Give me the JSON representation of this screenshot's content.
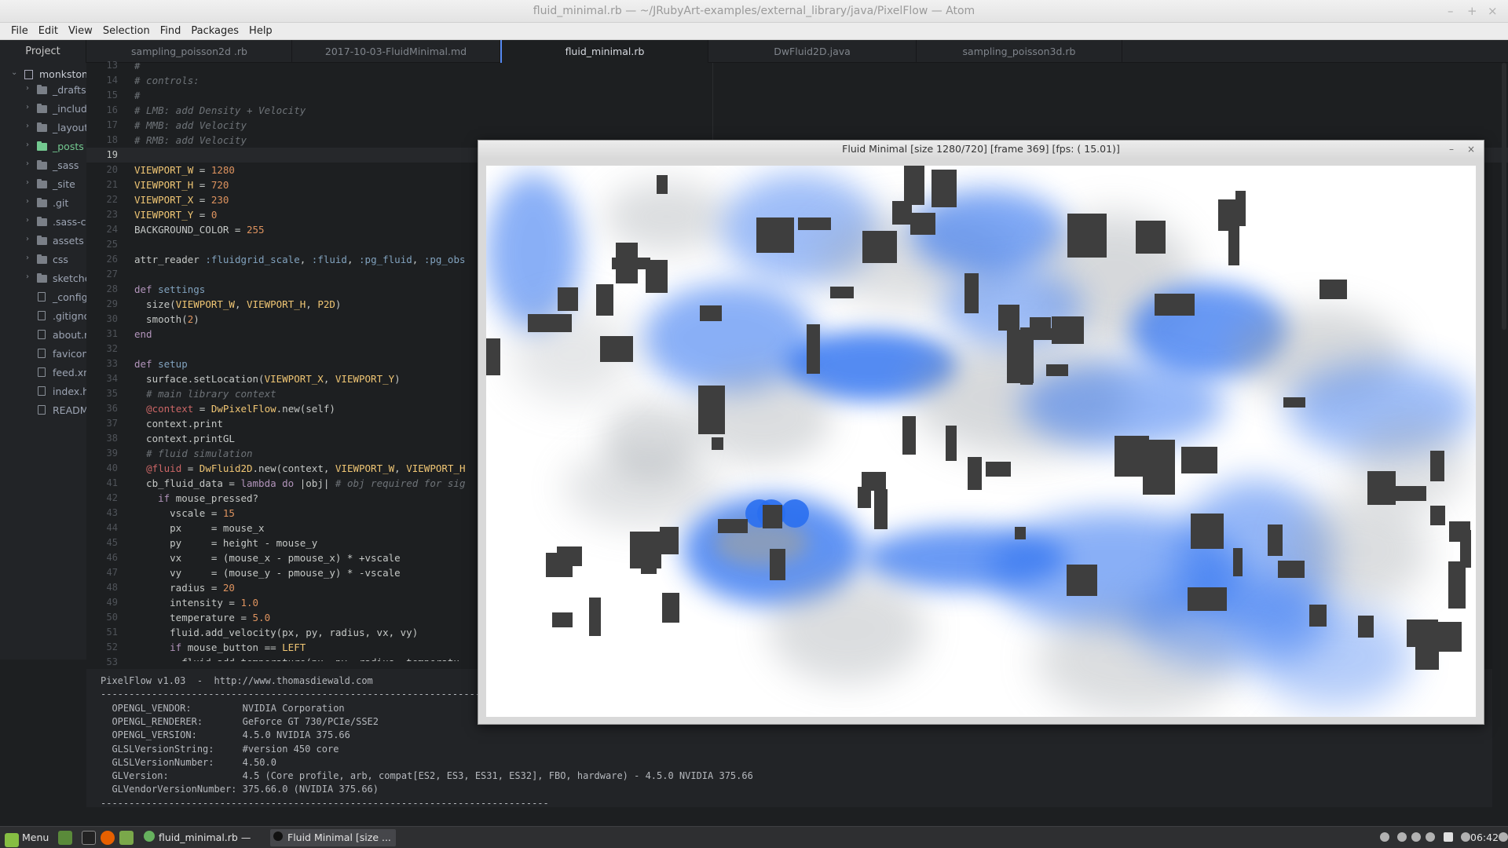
{
  "window": {
    "title": "fluid_minimal.rb — ~/JRubyArt-examples/external_library/java/PixelFlow — Atom",
    "controls": [
      "–",
      "+",
      "×"
    ]
  },
  "menu": [
    "File",
    "Edit",
    "View",
    "Selection",
    "Find",
    "Packages",
    "Help"
  ],
  "tabs": {
    "project": "Project",
    "items": [
      {
        "label": "sampling_poisson2d .rb",
        "active": false
      },
      {
        "label": "2017-10-03-FluidMinimal.md",
        "active": false
      },
      {
        "label": "fluid_minimal.rb",
        "active": true
      },
      {
        "label": "DwFluid2D.java",
        "active": false
      },
      {
        "label": "sampling_poisson3d.rb",
        "active": false
      }
    ]
  },
  "tree": {
    "root": "monkstone",
    "items": [
      {
        "label": "_drafts",
        "type": "folder"
      },
      {
        "label": "_includ",
        "type": "folder"
      },
      {
        "label": "_layout",
        "type": "folder"
      },
      {
        "label": "_posts",
        "type": "folder",
        "selected": true
      },
      {
        "label": "_sass",
        "type": "folder"
      },
      {
        "label": "_site",
        "type": "folder"
      },
      {
        "label": ".git",
        "type": "folder"
      },
      {
        "label": ".sass-ca",
        "type": "folder"
      },
      {
        "label": "assets",
        "type": "folder"
      },
      {
        "label": "css",
        "type": "folder"
      },
      {
        "label": "sketche",
        "type": "folder"
      },
      {
        "label": "_config",
        "type": "file"
      },
      {
        "label": ".gitigno",
        "type": "file"
      },
      {
        "label": "about.r",
        "type": "file"
      },
      {
        "label": "favicon",
        "type": "file"
      },
      {
        "label": "feed.xn",
        "type": "file"
      },
      {
        "label": "index.h",
        "type": "file"
      },
      {
        "label": "READM",
        "type": "file"
      }
    ]
  },
  "editor": {
    "first_line": 13,
    "current_line": 19,
    "lines": [
      "#",
      "# controls:",
      "#",
      "# LMB: add Density + Velocity",
      "# MMB: add Velocity",
      "# RMB: add Velocity",
      "",
      "VIEWPORT_W = 1280",
      "VIEWPORT_H = 720",
      "VIEWPORT_X = 230",
      "VIEWPORT_Y = 0",
      "BACKGROUND_COLOR = 255",
      "",
      "attr_reader :fluidgrid_scale, :fluid, :pg_fluid, :pg_obs",
      "",
      "def settings",
      "  size(VIEWPORT_W, VIEWPORT_H, P2D)",
      "  smooth(2)",
      "end",
      "",
      "def setup",
      "  surface.setLocation(VIEWPORT_X, VIEWPORT_Y)",
      "  # main library context",
      "  @context = DwPixelFlow.new(self)",
      "  context.print",
      "  context.printGL",
      "  # fluid simulation",
      "  @fluid = DwFluid2D.new(context, VIEWPORT_W, VIEWPORT_H",
      "  cb_fluid_data = lambda do |obj| # obj required for sig",
      "    if mouse_pressed?",
      "      vscale = 15",
      "      px     = mouse_x",
      "      py     = height - mouse_y",
      "      vx     = (mouse_x - pmouse_x) * +vscale",
      "      vy     = (mouse_y - pmouse_y) * -vscale",
      "      radius = 20",
      "      intensity = 1.0",
      "      temperature = 5.0",
      "      fluid.add_velocity(px, py, radius, vx, vy)",
      "      if mouse_button == LEFT",
      "        fluid.add_temperature(px, py, radius, temperatu"
    ]
  },
  "console": {
    "lines": [
      "PixelFlow v1.03  -  http://www.thomasdiewald.com",
      "-------------------------------------------------------------------------------",
      "  OPENGL_VENDOR:         NVIDIA Corporation",
      "  OPENGL_RENDERER:       GeForce GT 730/PCIe/SSE2",
      "  OPENGL_VERSION:        4.5.0 NVIDIA 375.66",
      "  GLSLVersionString:     #version 450 core",
      "  GLSLVersionNumber:     4.50.0",
      "  GLVersion:             4.5 (Core profile, arb, compat[ES2, ES3, ES31, ES32], FBO, hardware) - 4.5.0 NVIDIA 375.66",
      "  GLVendorVersionNumber: 375.66.0 (NVIDIA 375.66)",
      "-------------------------------------------------------------------------------"
    ]
  },
  "sketch": {
    "title": "Fluid Minimal  [size 1280/720]  [frame 369]  [fps: ( 15.01)]",
    "controls": [
      "–",
      "×"
    ],
    "colors": {
      "fluid": "#2a6ff0",
      "smoke": "#9aa0a6",
      "obstacle": "#3e3e3e",
      "background": "#ffffff"
    }
  },
  "taskbar": {
    "menu_label": "Menu",
    "windows": [
      {
        "label": "fluid_minimal.rb — ~...",
        "active": false
      },
      {
        "label": "Fluid Minimal  [size ...",
        "active": true
      }
    ],
    "clock": "06:42",
    "tray_icons": [
      "user-icon",
      "pen-icon",
      "volume-icon",
      "brightness-icon",
      "shield-icon",
      "battery-icon",
      "display-icon"
    ]
  }
}
